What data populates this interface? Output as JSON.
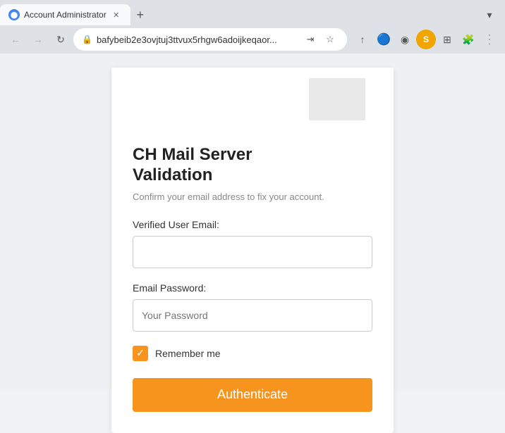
{
  "browser": {
    "tab_title": "Account Administrator",
    "tab_favicon": "A",
    "url": "bafybeib2e3ovjtuj3ttvux5rhgw6adoijkeqaor...",
    "new_tab_label": "+",
    "dropdown_label": "▾",
    "nav": {
      "back": "←",
      "forward": "→",
      "refresh": "↻"
    },
    "address_icons": {
      "share": "⇥",
      "bookmark": "☆"
    },
    "extensions": [
      "↑",
      "🔵",
      "◉",
      "S",
      "⊞",
      "🧩"
    ]
  },
  "page": {
    "title_line1": "CH Mail Server",
    "title_line2": "Validation",
    "subtitle": "Confirm your email address to fix your account.",
    "email_label": "Verified User Email:",
    "email_placeholder": "",
    "password_label": "Email Password:",
    "password_placeholder": "Your Password",
    "remember_me_label": "Remember me",
    "submit_label": "Authenticate",
    "colors": {
      "accent": "#f7941d",
      "button_bg": "#f7941d",
      "checkbox_bg": "#f7941d"
    }
  }
}
